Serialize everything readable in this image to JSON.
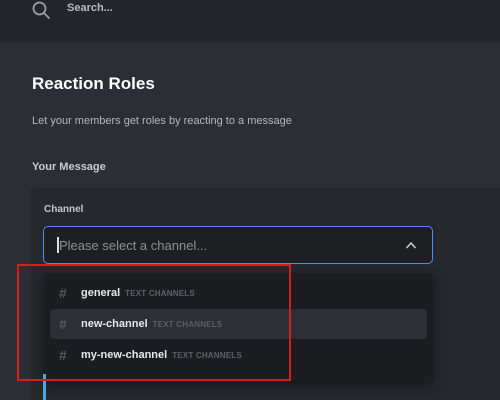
{
  "search": {
    "label": "Search...",
    "icon": "search-icon"
  },
  "page": {
    "title": "Reaction Roles",
    "subtitle": "Let your members get roles by reacting to a message"
  },
  "section": {
    "label": "Your Message"
  },
  "channel_field": {
    "label": "Channel",
    "placeholder": "Please select a channel...",
    "icon": "chevron-up-icon"
  },
  "dropdown": {
    "options": [
      {
        "name": "general",
        "type": "TEXT CHANNELS",
        "hovered": false
      },
      {
        "name": "new-channel",
        "type": "TEXT CHANNELS",
        "hovered": true
      },
      {
        "name": "my-new-channel",
        "type": "TEXT CHANNELS",
        "hovered": false
      }
    ]
  },
  "colors": {
    "focus_border": "#4d8ff0",
    "highlight_annotation": "#d51f1f"
  }
}
